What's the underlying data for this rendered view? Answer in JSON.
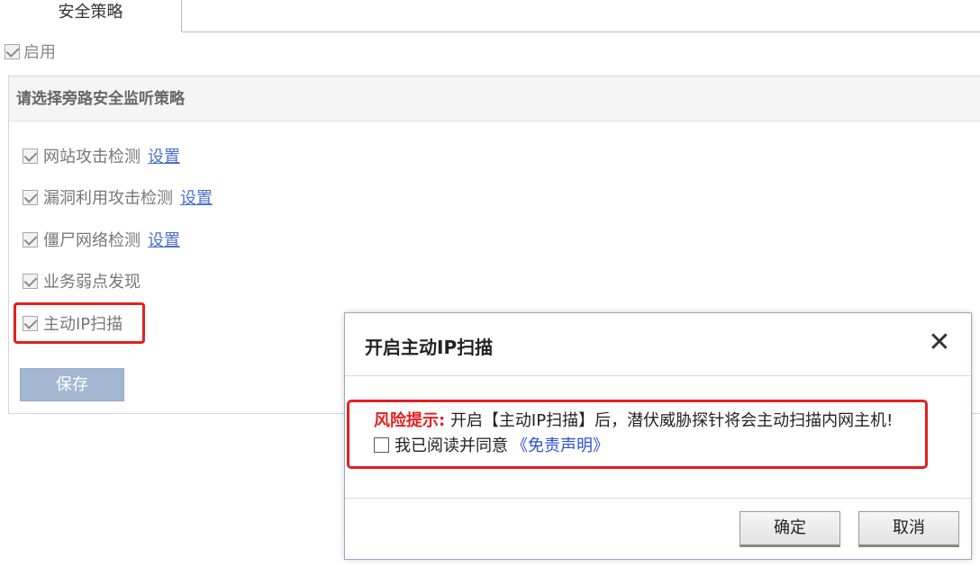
{
  "tabs": [
    {
      "label": "安全策略",
      "active": true
    }
  ],
  "enable": {
    "label": "启用",
    "checked": true
  },
  "panel": {
    "title": "请选择旁路安全监听策略",
    "options": [
      {
        "label": "网站攻击检测",
        "setting_link": "设置",
        "checked": true
      },
      {
        "label": "漏洞利用攻击检测",
        "setting_link": "设置",
        "checked": true
      },
      {
        "label": "僵尸网络检测",
        "setting_link": "设置",
        "checked": true
      },
      {
        "label": "业务弱点发现",
        "checked": true
      },
      {
        "label": "主动IP扫描",
        "checked": true
      }
    ],
    "save_label": "保存"
  },
  "dialog": {
    "title": "开启主动IP扫描",
    "close_symbol": "✕",
    "risk_prefix": "风险提示:",
    "risk_text": "开启【主动IP扫描】后，潜伏威胁探针将会主动扫描内网主机!",
    "agree_label": "我已阅读并同意",
    "disclaimer_link": "《免责声明》",
    "agree_checked": false,
    "ok_label": "确定",
    "cancel_label": "取消"
  },
  "colors": {
    "highlight": "#e3201f",
    "link": "#4a6fc9",
    "disclaimer": "#2d4fd0",
    "save_button": "#a3b7d2"
  }
}
